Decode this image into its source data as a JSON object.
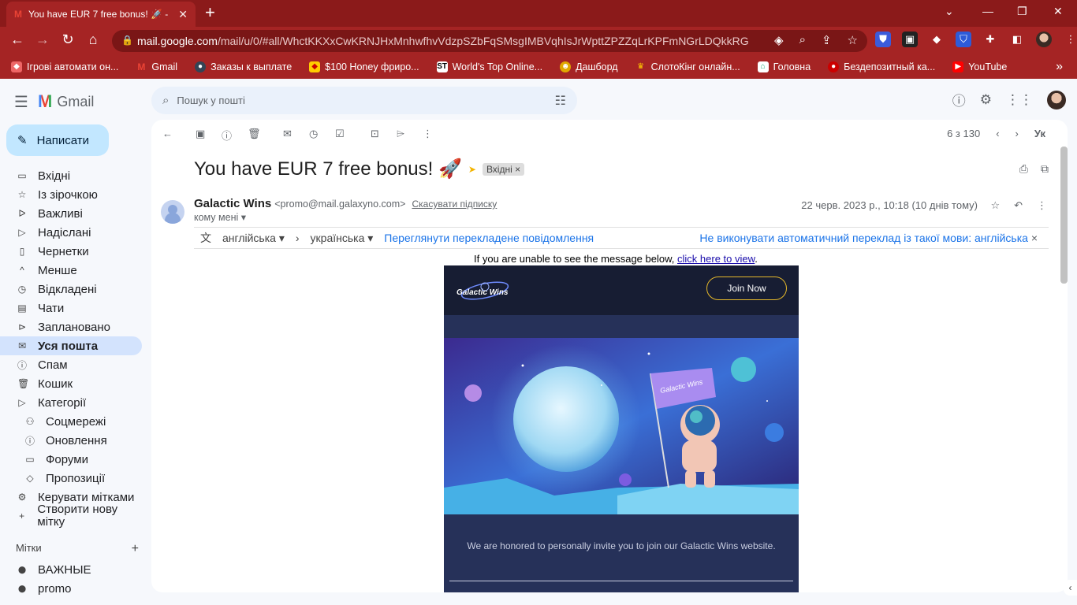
{
  "browser": {
    "tab_title": "You have EUR 7 free bonus! 🚀 -",
    "tab_close": "✕",
    "new_tab": "+",
    "url_host": "mail.google.com",
    "url_path": "/mail/u/0/#all/WhctKKXxCwKRNJHxMnhwfhvVdzpSZbFqSMsgIMBVqhIsJrWpttZPZZqLrKPFmNGrLDQkkRG",
    "bookmarks": [
      "Ігрові автомати он...",
      "Gmail",
      "Заказы к выплате",
      "$100 Honey фриро...",
      "World's Top Online...",
      "Дашборд",
      "СлотоКінг онлайн...",
      "Головна",
      "Бездепозитный ка...",
      "YouTube"
    ],
    "bookmarks_more": "»"
  },
  "gmail": {
    "product_name": "Gmail",
    "search_placeholder": "Пошук у пошті",
    "compose_label": "Написати",
    "nav_items": [
      {
        "label": "Вхідні",
        "icon": "inbox-icon",
        "glyph": "▭"
      },
      {
        "label": "Із зірочкою",
        "icon": "star-icon",
        "glyph": "☆"
      },
      {
        "label": "Важливі",
        "icon": "important-icon",
        "glyph": "ᐅ"
      },
      {
        "label": "Надіслані",
        "icon": "send-icon",
        "glyph": "▷"
      },
      {
        "label": "Чернетки",
        "icon": "draft-icon",
        "glyph": "▯"
      },
      {
        "label": "Менше",
        "icon": "chevron-up-icon",
        "glyph": "^"
      },
      {
        "label": "Відкладені",
        "icon": "clock-icon",
        "glyph": "◷"
      },
      {
        "label": "Чати",
        "icon": "chat-icon",
        "glyph": "▤"
      },
      {
        "label": "Заплановано",
        "icon": "schedule-icon",
        "glyph": "⊳"
      },
      {
        "label": "Уся пошта",
        "icon": "all-mail-icon",
        "glyph": "✉"
      },
      {
        "label": "Спам",
        "icon": "spam-icon",
        "glyph": "ⓘ"
      },
      {
        "label": "Кошик",
        "icon": "trash-icon",
        "glyph": "🗑"
      },
      {
        "label": "Категорії",
        "icon": "category-icon",
        "glyph": "▷"
      },
      {
        "label": "Соцмережі",
        "icon": "social-icon",
        "glyph": "⚇"
      },
      {
        "label": "Оновлення",
        "icon": "updates-icon",
        "glyph": "ⓘ"
      },
      {
        "label": "Форуми",
        "icon": "forums-icon",
        "glyph": "▭"
      },
      {
        "label": "Пропозиції",
        "icon": "tag-icon",
        "glyph": "◇"
      },
      {
        "label": "Керувати мітками",
        "icon": "settings-icon",
        "glyph": "⚙"
      },
      {
        "label": "Створити нову мітку",
        "icon": "plus-icon",
        "glyph": "+"
      }
    ],
    "labels_title": "Мітки",
    "labels_add": "+",
    "labels": [
      {
        "label": "ВАЖНЫЕ",
        "icon": "label-icon",
        "glyph": "⬤"
      },
      {
        "label": "promo",
        "icon": "label-icon",
        "glyph": "⬤"
      }
    ]
  },
  "message": {
    "pager_text": "6 з 130",
    "input_tool": "Ук",
    "subject": "You have EUR 7 free bonus! 🚀",
    "inbox_chip": "Вхідні ×",
    "sender_name": "Galactic Wins",
    "sender_email": "<promo@mail.galaxyno.com>",
    "unsubscribe": "Скасувати підписку",
    "to": "кому мені ▾",
    "date": "22 черв. 2023 р., 10:18 (10 днів тому)",
    "translate": {
      "from_lang": "англійська ▾",
      "arrow": "›",
      "to_lang": "українська ▾",
      "view_translated": "Переглянути перекладене повідомлення",
      "no_auto": "Не виконувати автоматичний переклад із такої мови: англійська",
      "close": "×"
    },
    "unable_text": "If you are unable to see the message below, ",
    "unable_link": "click here to view",
    "unable_end": ".",
    "email": {
      "logo": "Galactic Wins",
      "join": "Join Now",
      "invite": "We are honored to personally invite you to join our Galactic Wins website."
    }
  }
}
